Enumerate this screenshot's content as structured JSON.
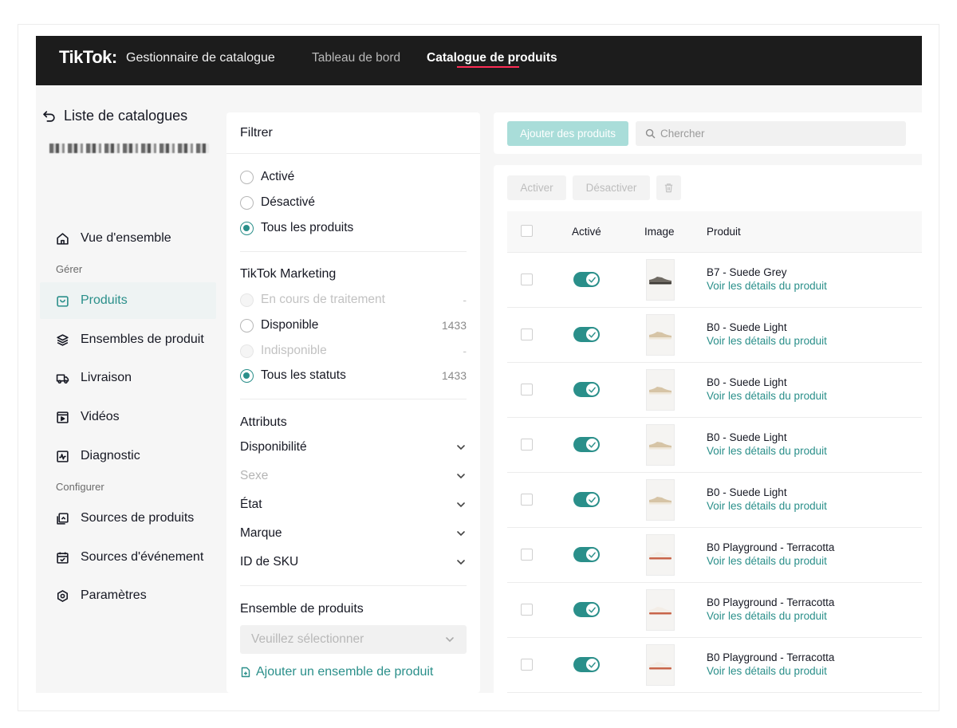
{
  "header": {
    "logo": "TikTok",
    "app_name": "Gestionnaire de catalogue",
    "nav": [
      {
        "label": "Tableau de bord",
        "active": false
      },
      {
        "label": "Catalogue de produits",
        "active": true
      }
    ]
  },
  "sidebar": {
    "back_title": "Liste de catalogues",
    "items": [
      {
        "label": "Vue d'ensemble",
        "icon": "home-icon"
      },
      {
        "label": "Produits",
        "icon": "bag-icon",
        "active": true
      },
      {
        "label": "Ensembles de produit",
        "icon": "layers-icon"
      },
      {
        "label": "Livraison",
        "icon": "truck-icon"
      },
      {
        "label": "Vidéos",
        "icon": "video-icon"
      },
      {
        "label": "Diagnostic",
        "icon": "pulse-icon"
      },
      {
        "label": "Sources de produits",
        "icon": "sources-icon"
      },
      {
        "label": "Sources d'événement",
        "icon": "calendar-icon"
      },
      {
        "label": "Paramètres",
        "icon": "settings-icon"
      }
    ],
    "sections": {
      "manage": "Gérer",
      "configure": "Configurer"
    }
  },
  "filter": {
    "title": "Filtrer",
    "status": [
      {
        "label": "Activé",
        "checked": false
      },
      {
        "label": "Désactivé",
        "checked": false
      },
      {
        "label": "Tous les produits",
        "checked": true
      }
    ],
    "marketing_title": "TikTok Marketing",
    "marketing": [
      {
        "label": "En cours de traitement",
        "count": "-",
        "disabled": true
      },
      {
        "label": "Disponible",
        "count": "1433",
        "disabled": false
      },
      {
        "label": "Indisponible",
        "count": "-",
        "disabled": true
      },
      {
        "label": "Tous les statuts",
        "count": "1433",
        "checked": true
      }
    ],
    "attributes_title": "Attributs",
    "attributes": [
      {
        "label": "Disponibilité",
        "disabled": false
      },
      {
        "label": "Sexe",
        "disabled": true
      },
      {
        "label": "État",
        "disabled": false
      },
      {
        "label": "Marque",
        "disabled": false
      },
      {
        "label": "ID de SKU",
        "disabled": false
      }
    ],
    "product_set_title": "Ensemble de produits",
    "select_placeholder": "Veuillez sélectionner",
    "add_set_label": "Ajouter un ensemble de produit"
  },
  "toolbar": {
    "add_products": "Ajouter des produits",
    "search_placeholder": "Chercher"
  },
  "actions": {
    "activate": "Activer",
    "deactivate": "Désactiver"
  },
  "table": {
    "columns": [
      "Activé",
      "Image",
      "Produit"
    ],
    "link_label": "Voir les détails du produit",
    "rows": [
      {
        "name": "B7 - Suede Grey",
        "active": true,
        "shoe_color": "#6f6a63",
        "sole_color": "#3e3b37"
      },
      {
        "name": "B0 - Suede Light",
        "active": true,
        "shoe_color": "#d6c4a6",
        "sole_color": "#eee6d8"
      },
      {
        "name": "B0 - Suede Light",
        "active": true,
        "shoe_color": "#d6c4a6",
        "sole_color": "#eee6d8"
      },
      {
        "name": "B0 - Suede Light",
        "active": true,
        "shoe_color": "#d6c4a6",
        "sole_color": "#eee6d8"
      },
      {
        "name": "B0 - Suede Light",
        "active": true,
        "shoe_color": "#d6c4a6",
        "sole_color": "#eee6d8"
      },
      {
        "name": "B0 Playground - Terracotta",
        "active": true,
        "shoe_color": "#f3ede6",
        "sole_color": "#c8654a"
      },
      {
        "name": "B0 Playground - Terracotta",
        "active": true,
        "shoe_color": "#f3ede6",
        "sole_color": "#c8654a"
      },
      {
        "name": "B0 Playground - Terracotta",
        "active": true,
        "shoe_color": "#f3ede6",
        "sole_color": "#c8654a"
      }
    ]
  },
  "colors": {
    "accent": "#2a8f8a",
    "nav_underline": "#fe2c55",
    "topbar": "#1c1c1c"
  }
}
